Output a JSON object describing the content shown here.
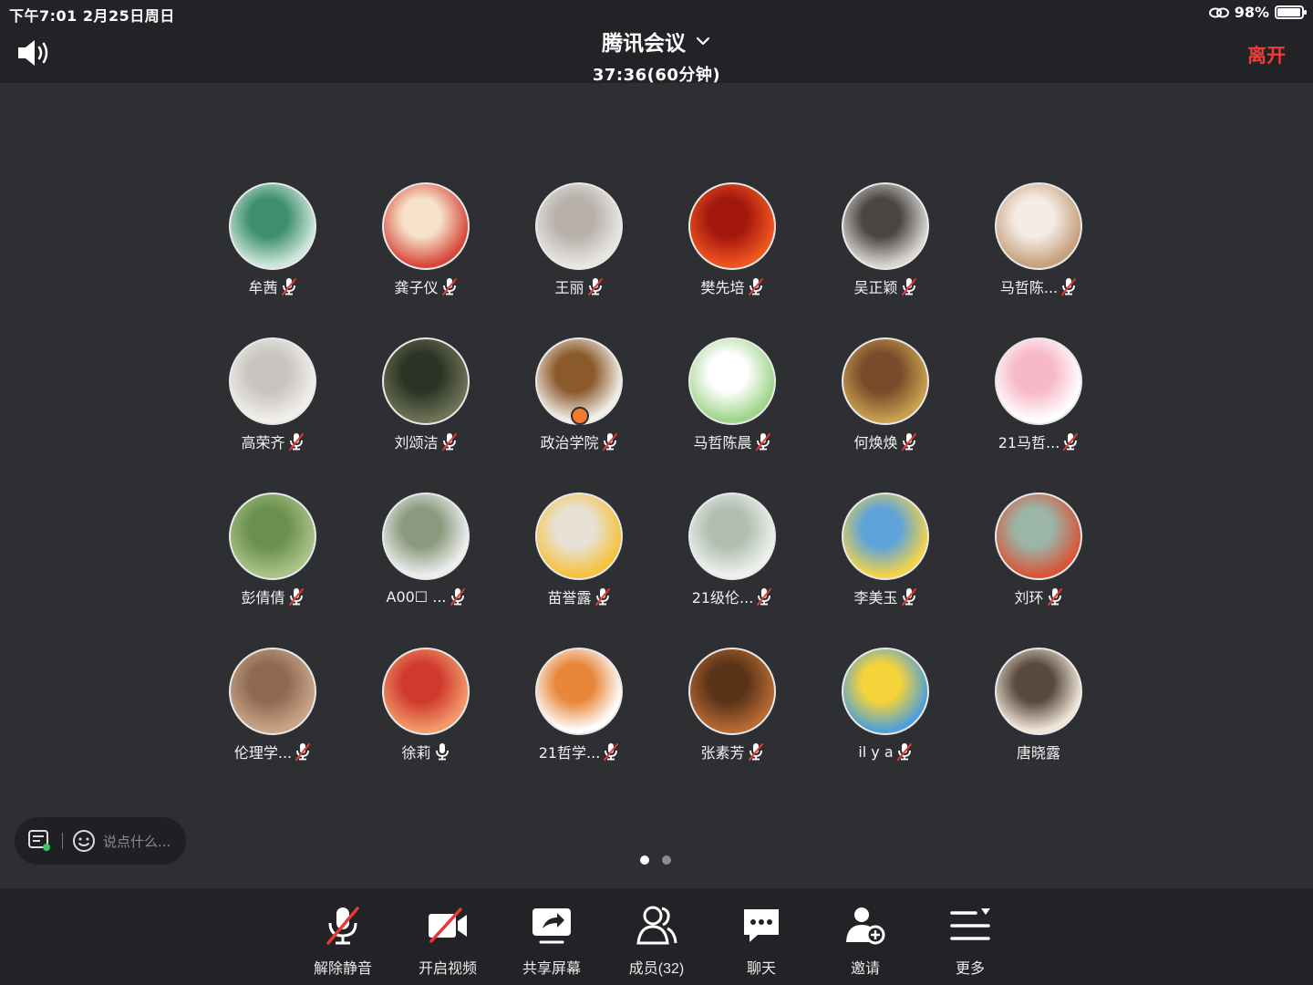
{
  "status_bar": {
    "time": "下午7:01   2月25日周日",
    "battery": "98%"
  },
  "header": {
    "title": "腾讯会议",
    "elapsed": "37:36(60分钟)",
    "leave_label": "离开"
  },
  "participants": [
    {
      "name": "牟茜",
      "mic": "muted",
      "colors": [
        "#cfe6dc",
        "#3f8f6e"
      ]
    },
    {
      "name": "龚子仪",
      "mic": "muted",
      "colors": [
        "#d8473c",
        "#f5e2c8"
      ]
    },
    {
      "name": "王丽",
      "mic": "muted",
      "colors": [
        "#e8e6e2",
        "#b8b0aa"
      ]
    },
    {
      "name": "樊先培",
      "mic": "muted",
      "colors": [
        "#f0561e",
        "#a3180e"
      ]
    },
    {
      "name": "吴正颖",
      "mic": "muted",
      "colors": [
        "#d9d6d2",
        "#4b4644"
      ]
    },
    {
      "name": "马哲陈...",
      "mic": "muted",
      "colors": [
        "#c7a07c",
        "#f4ece6"
      ]
    },
    {
      "name": "高荣齐",
      "mic": "muted",
      "colors": [
        "#f1efec",
        "#c8c4bf"
      ]
    },
    {
      "name": "刘颂洁",
      "mic": "muted",
      "colors": [
        "#6c7356",
        "#2d3324"
      ]
    },
    {
      "name": "政治学院",
      "mic": "muted",
      "colors": [
        "#f3efe9",
        "#8b5a2b"
      ],
      "host": true
    },
    {
      "name": "马哲陈晨",
      "mic": "muted",
      "colors": [
        "#9fd58a",
        "#ffffff"
      ]
    },
    {
      "name": "何焕焕",
      "mic": "muted",
      "colors": [
        "#c9a04f",
        "#7a4a2a"
      ]
    },
    {
      "name": "21马哲...",
      "mic": "muted",
      "colors": [
        "#ffffff",
        "#f7b8c8"
      ]
    },
    {
      "name": "彭倩倩",
      "mic": "muted",
      "colors": [
        "#a8c489",
        "#6b8f4c"
      ]
    },
    {
      "name": "A00☐  ...",
      "mic": "muted",
      "colors": [
        "#eeeeee",
        "#8a9a7e"
      ]
    },
    {
      "name": "苗誉露",
      "mic": "muted",
      "colors": [
        "#f4c23c",
        "#e8e2d6"
      ]
    },
    {
      "name": "21级伦...",
      "mic": "muted",
      "colors": [
        "#eef0ee",
        "#b0bfb0"
      ]
    },
    {
      "name": "李美玉",
      "mic": "muted",
      "colors": [
        "#f3d34a",
        "#5ea3d9"
      ]
    },
    {
      "name": "刘环",
      "mic": "muted",
      "colors": [
        "#d8553a",
        "#9bb5a6"
      ]
    },
    {
      "name": "伦理学...",
      "mic": "muted",
      "colors": [
        "#c9a588",
        "#8e6a52"
      ]
    },
    {
      "name": "徐莉",
      "mic": "on",
      "colors": [
        "#f29a6a",
        "#d03a2e"
      ]
    },
    {
      "name": "21哲学...",
      "mic": "muted",
      "colors": [
        "#ffffff",
        "#e8873a"
      ]
    },
    {
      "name": "张素芳",
      "mic": "muted",
      "colors": [
        "#b86a32",
        "#5a3318"
      ]
    },
    {
      "name": "il y a",
      "mic": "muted",
      "colors": [
        "#4fa0d8",
        "#f5d33a"
      ]
    },
    {
      "name": "唐晓露",
      "mic": "none",
      "colors": [
        "#efe6d8",
        "#5a4a3e"
      ]
    }
  ],
  "chat": {
    "placeholder": "说点什么..."
  },
  "pagination": {
    "pages": 2,
    "current": 1
  },
  "toolbar": {
    "unmute": "解除静音",
    "video": "开启视频",
    "share": "共享屏幕",
    "members": "成员(32)",
    "chat": "聊天",
    "invite": "邀请",
    "more": "更多"
  }
}
